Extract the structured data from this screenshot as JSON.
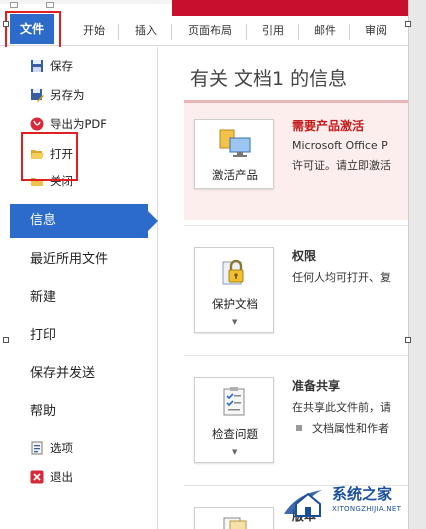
{
  "ribbon": {
    "tabs": [
      "文件",
      "开始",
      "插入",
      "页面布局",
      "引用",
      "邮件",
      "审阅"
    ]
  },
  "leftnav": {
    "small_items_top": [
      {
        "label": "保存",
        "icon": "save-icon"
      },
      {
        "label": "另存为",
        "icon": "save-as-icon"
      },
      {
        "label": "导出为PDF",
        "icon": "pdf-icon"
      },
      {
        "label": "打开",
        "icon": "folder-open-icon"
      },
      {
        "label": "关闭",
        "icon": "folder-close-icon"
      }
    ],
    "selected": "信息",
    "big_items": [
      "最近所用文件",
      "新建",
      "打印",
      "保存并发送",
      "帮助"
    ],
    "small_items_bottom": [
      {
        "label": "选项",
        "icon": "options-icon"
      },
      {
        "label": "退出",
        "icon": "exit-icon"
      }
    ]
  },
  "main": {
    "title": "有关 文档1 的信息",
    "activate": {
      "button_label": "激活产品",
      "title": "需要产品激活",
      "line1": "Microsoft Office P",
      "line2": "许可证。请立即激活"
    },
    "permissions": {
      "button_label": "保护文档",
      "title": "权限",
      "line1": "任何人均可打开、复"
    },
    "share": {
      "button_label": "检查问题",
      "title": "准备共享",
      "line1": "在共享此文件前，请",
      "bullet": "文档属性和作者"
    },
    "versions": {
      "partial_text": "版本"
    }
  },
  "watermark": {
    "name": "系统之家",
    "url": "XITONGZHIJIA.NET"
  },
  "colors": {
    "accent_blue": "#2d6bcb",
    "highlight_red": "#e02020",
    "activation_bg": "#fdeeee",
    "activation_title": "#c41a1a"
  }
}
